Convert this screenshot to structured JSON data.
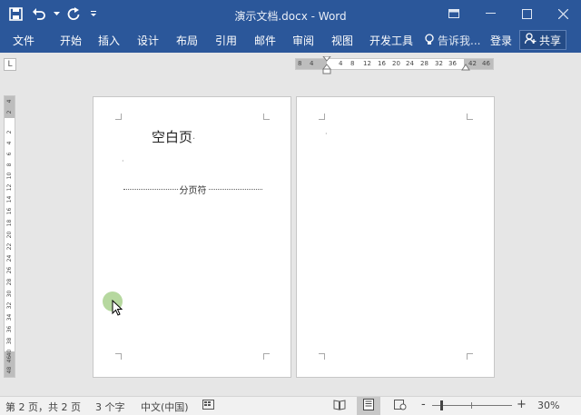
{
  "titlebar": {
    "title": "演示文档.docx - Word",
    "qat_icons": [
      "save-icon",
      "undo-icon",
      "redo-icon",
      "customize-qat-icon"
    ],
    "window_icons": [
      "ribbon-display-options-icon",
      "minimize-icon",
      "maximize-icon",
      "close-icon"
    ]
  },
  "ribbon": {
    "tabs": [
      "文件",
      "开始",
      "插入",
      "设计",
      "布局",
      "引用",
      "邮件",
      "审阅",
      "视图",
      "开发工具"
    ],
    "tellme": "告诉我...",
    "login": "登录",
    "share": "共享"
  },
  "ruler": {
    "h_left": [
      "8",
      "4"
    ],
    "h_mid": [
      "4",
      "8",
      "12",
      "16",
      "20",
      "24",
      "28",
      "32",
      "36"
    ],
    "h_right": [
      "42",
      "46"
    ],
    "corner": "L",
    "v_top": [
      "4",
      "2"
    ],
    "v_mid": [
      "2",
      "4",
      "6",
      "8",
      "10",
      "12",
      "14",
      "16",
      "18",
      "20",
      "22",
      "24",
      "26",
      "28",
      "30",
      "32",
      "34",
      "36",
      "38",
      "40",
      "42"
    ],
    "v_bot": [
      "46",
      "48"
    ]
  },
  "document": {
    "page1_heading": "空白页",
    "page_break_label": "分页符",
    "paragraph_mark": "·"
  },
  "status": {
    "page": "第 2 页，共 2 页",
    "words": "3 个字",
    "language": "中文(中国)",
    "zoom_percent": "30%",
    "zoom_minus": "-",
    "zoom_plus": "+",
    "zoom_value": 30,
    "active_view": "print-layout"
  },
  "colors": {
    "ribbon": "#2b579a",
    "click_indicator": "#a9d18e"
  }
}
